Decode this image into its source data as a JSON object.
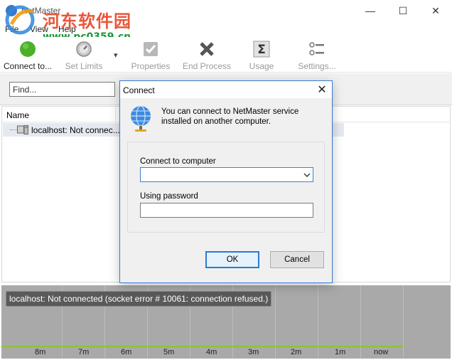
{
  "window": {
    "title": "NetMaster",
    "minimize_glyph": "—",
    "maximize_glyph": "☐",
    "close_glyph": "✕"
  },
  "watermark": {
    "site_name": "河东软件园",
    "url": "www.pc0359.cn"
  },
  "menu": {
    "items": [
      "File",
      "View",
      "Help"
    ]
  },
  "toolbar": {
    "buttons": [
      {
        "label": "Connect to...",
        "icon": "green-circle-icon",
        "enabled": true
      },
      {
        "label": "Set Limits",
        "icon": "gauge-icon",
        "enabled": false
      },
      {
        "label": "Properties",
        "icon": "checkbox-icon",
        "enabled": false
      },
      {
        "label": "End Process",
        "icon": "x-mark-icon",
        "enabled": false
      },
      {
        "label": "Usage",
        "icon": "sigma-icon",
        "enabled": false
      },
      {
        "label": "Settings...",
        "icon": "settings-list-icon",
        "enabled": false
      }
    ],
    "dropdown_glyph": "▾"
  },
  "find": {
    "placeholder": "Find..."
  },
  "list": {
    "column_name": "Name",
    "rows": [
      {
        "label": "localhost: Not connec...",
        "icon": "computer-icon"
      }
    ]
  },
  "graph": {
    "status_text": "localhost: Not connected (socket error # 10061: connection refused.)",
    "time_labels": [
      "8m",
      "7m",
      "6m",
      "5m",
      "4m",
      "3m",
      "2m",
      "1m",
      "now"
    ]
  },
  "dialog": {
    "title": "Connect",
    "close_glyph": "✕",
    "message": "You can connect to NetMaster service installed on another computer.",
    "computer_label": "Connect to computer",
    "computer_value": "",
    "password_label": "Using password",
    "password_value": "",
    "ok_label": "OK",
    "cancel_label": "Cancel"
  },
  "colors": {
    "accent": "#3a7bd5",
    "connect_green": "#4caf2a",
    "graph_background": "#a9a9a9",
    "graph_line": "#8cc23b"
  }
}
